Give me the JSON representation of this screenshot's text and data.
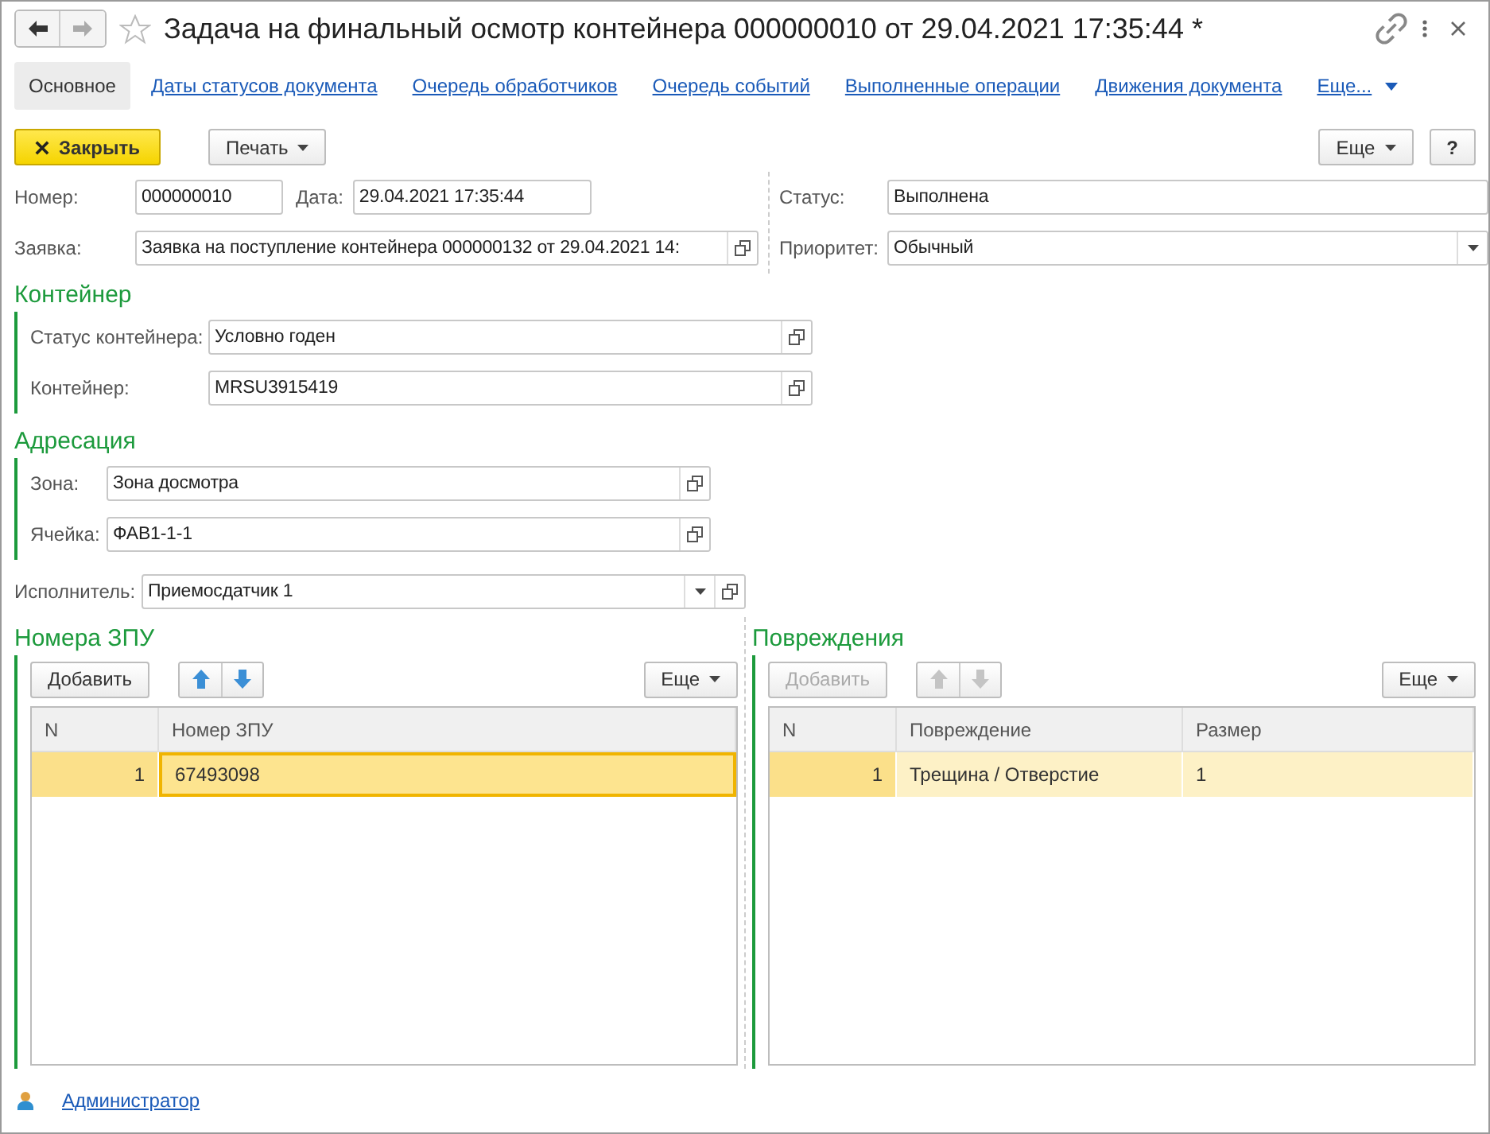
{
  "window": {
    "title": "Задача на финальный осмотр контейнера 000000010 от 29.04.2021 17:35:44 *"
  },
  "tabs": [
    {
      "label": "Основное",
      "selected": true
    },
    {
      "label": "Даты статусов документа",
      "selected": false
    },
    {
      "label": "Очередь обработчиков",
      "selected": false
    },
    {
      "label": "Очередь событий",
      "selected": false
    },
    {
      "label": "Выполненные операции",
      "selected": false
    },
    {
      "label": "Движения документа",
      "selected": false
    }
  ],
  "more_tabs": "Еще...",
  "toolbar": {
    "close_button": "Закрыть",
    "print_button": "Печать",
    "more_button": "Еще",
    "help_button": "?"
  },
  "header_fields": {
    "number": {
      "label": "Номер:",
      "value": "000000010"
    },
    "date": {
      "label": "Дата:",
      "value": "29.04.2021 17:35:44"
    },
    "request": {
      "label": "Заявка:",
      "value": "Заявка на поступление контейнера 000000132 от 29.04.2021 14:"
    },
    "status": {
      "label": "Статус:",
      "value": "Выполнена"
    },
    "priority": {
      "label": "Приоритет:",
      "value": "Обычный"
    }
  },
  "container": {
    "title": "Контейнер",
    "fields": [
      {
        "label": "Статус контейнера:",
        "value": "Условно годен"
      },
      {
        "label": "Контейнер:",
        "value": "MRSU3915419"
      }
    ]
  },
  "addressing": {
    "title": "Адресация",
    "fields": [
      {
        "label": "Зона:",
        "value": "Зона досмотра"
      },
      {
        "label": "Ячейка:",
        "value": "ФАВ1-1-1"
      }
    ]
  },
  "executor": {
    "label": "Исполнитель:",
    "value": "Приемосдатчик 1"
  },
  "tables": [
    {
      "title": "Номера ЗПУ",
      "add_button": "Добавить",
      "add_disabled": false,
      "move_disabled": false,
      "more_button": "Еще",
      "active": true,
      "columns": [
        "N",
        "Номер ЗПУ"
      ],
      "rows": [
        {
          "cells": [
            "1",
            "67493098"
          ],
          "selected": true
        }
      ]
    },
    {
      "title": "Повреждения",
      "add_button": "Добавить",
      "add_disabled": true,
      "move_disabled": true,
      "more_button": "Еще",
      "active": false,
      "columns": [
        "N",
        "Повреждение",
        "Размер"
      ],
      "rows": [
        {
          "cells": [
            "1",
            "Трещина / Отверстие",
            "1"
          ],
          "selected": true
        }
      ]
    }
  ],
  "footer": {
    "user": "Администратор"
  }
}
